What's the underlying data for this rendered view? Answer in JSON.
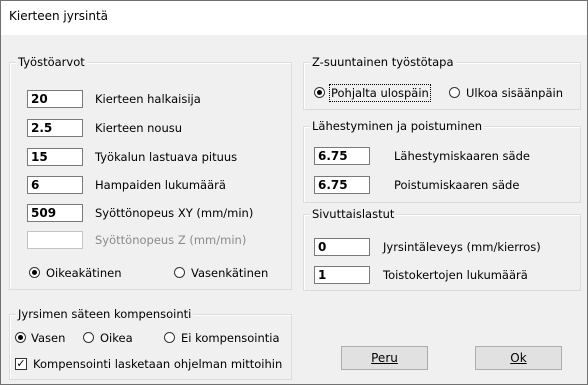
{
  "window": {
    "title": "Kierteen jyrsintä"
  },
  "tyostoarvot": {
    "legend": "Työstöarvot",
    "fields": [
      {
        "value": "20",
        "label": "Kierteen halkaisija"
      },
      {
        "value": "2.5",
        "label": "Kierteen nousu"
      },
      {
        "value": "15",
        "label": "Työkalun lastuava pituus"
      },
      {
        "value": "6",
        "label": "Hampaiden lukumäärä"
      },
      {
        "value": "509",
        "label": "Syöttönopeus XY   (mm/min)"
      },
      {
        "value": "",
        "label": "Syöttönopeus Z   (mm/min)"
      }
    ],
    "hand_right": "Oikeakätinen",
    "hand_left": "Vasenkätinen"
  },
  "z_tyostotapa": {
    "legend": "Z-suuntainen työstötapa",
    "option_bottom": "Pohjalta ulospäin",
    "option_outside": "Ulkoa sisäänpäin"
  },
  "lahestyminen": {
    "legend": "Lähestyminen ja poistuminen",
    "approach_value": "6.75",
    "approach_label": "Lähestymiskaaren säde",
    "exit_value": "6.75",
    "exit_label": "Poistumiskaaren säde"
  },
  "sivuttaislastut": {
    "legend": "Sivuttaislastut",
    "width_value": "0",
    "width_label": "Jyrsintäleveys (mm/kierros)",
    "repeat_value": "1",
    "repeat_label": "Toistokertojen lukumäärä"
  },
  "kompensointi": {
    "legend": "Jyrsimen säteen kompensointi",
    "left": "Vasen",
    "right": "Oikea",
    "none": "Ei kompensointia",
    "checkbox_label": "Kompensointi lasketaan ohjelman mittoihin"
  },
  "buttons": {
    "cancel": "Peru",
    "ok": "Ok"
  }
}
